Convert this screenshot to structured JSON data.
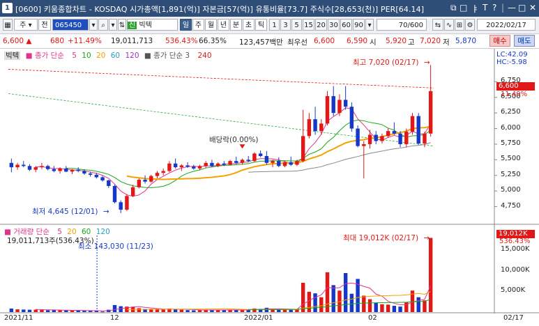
{
  "window": {
    "title": "[0600] 키움종합차트 - KOSDAQ 시가총액[1,891(억)] 자본금[57(억)] 유통비율[73.7] 주식수[28,653(천)] PER[64.14]",
    "icon_label": "1",
    "controls": [
      "⧉",
      "□",
      "ㅑ",
      "T",
      "?",
      "|",
      "—",
      "□",
      "✕"
    ]
  },
  "toolbar": {
    "mode": "주",
    "scope": "전",
    "code": "065450",
    "search_icon": "search-icon",
    "name_tag": "신",
    "stock_name": "빅텍",
    "period_buttons": [
      "일",
      "주",
      "월",
      "년",
      "분",
      "초",
      "틱"
    ],
    "active_period": "일",
    "intervals": [
      "1",
      "3",
      "5",
      "15",
      "20",
      "30",
      "60",
      "90"
    ],
    "count": "70",
    "count_total": "/600",
    "date": "2022/02/17"
  },
  "quote": {
    "price": "6,600",
    "arrow": "▲",
    "change": "680",
    "change_pct": "+11.49%",
    "volume": "19,011,713",
    "vol_ratio": "536.43%",
    "ratio2": "66.35%",
    "amount": "123,457백만",
    "best_ask_label": "최우선",
    "best_ask": "6,600",
    "best_bid": "6,590",
    "open_label": "시",
    "open": "5,920",
    "high_label": "고",
    "high": "7,020",
    "low_label": "저",
    "low": "5,870",
    "buy": "매수",
    "sell": "매도"
  },
  "price_legend": {
    "name": "빅텍",
    "ma_label": "종가 단순",
    "ma_periods": [
      "5",
      "10",
      "20",
      "60",
      "120"
    ],
    "ma_colors": [
      "#e1328d",
      "#19a619",
      "#f5a100",
      "#26a0c8",
      "#9b30c8"
    ],
    "ma2_label": "종가 단순 3",
    "ma2_period": "240"
  },
  "price_axis": {
    "ticks": [
      "6,750",
      "6,500",
      "6,250",
      "6,000",
      "5,750",
      "5,500",
      "5,250",
      "5,000",
      "4,750"
    ],
    "lc": "LC:42.09",
    "hc": "HC:-5.98",
    "current_price": "6,600",
    "current_pct": "11.49%"
  },
  "annotations": {
    "high": "최고 7,020 (02/17)",
    "low": "최저 4,645 (12/01)",
    "dividend": "배당락(0.00%)",
    "vol_max": "최대 19,012K (02/17)",
    "vol_min": "최소 143,030 (11/23)"
  },
  "volume_legend": {
    "label": "거래량 단순",
    "periods": [
      "5",
      "20",
      "60",
      "120"
    ],
    "colors": [
      "#e1328d",
      "#f5a100",
      "#19a619",
      "#26a0c8"
    ],
    "value_line": "19,011,713주(536.43%)"
  },
  "volume_axis": {
    "ticks": [
      "15,000K",
      "10,000K",
      "5,000K"
    ],
    "current": "19,012K",
    "current_pct": "536.43%"
  },
  "date_axis": [
    "2021/11",
    "12",
    "2022/01",
    "02",
    "02/17"
  ],
  "chart_data": {
    "type": "candlestick",
    "price_range": [
      4600,
      7100
    ],
    "volume_range_k": [
      0,
      20000
    ],
    "candles": [
      {
        "o": 5450,
        "h": 5520,
        "l": 5300,
        "c": 5380,
        "v": 900
      },
      {
        "o": 5380,
        "h": 5450,
        "l": 5340,
        "c": 5420,
        "v": 700
      },
      {
        "o": 5420,
        "h": 5480,
        "l": 5380,
        "c": 5400,
        "v": 650
      },
      {
        "o": 5400,
        "h": 5430,
        "l": 5320,
        "c": 5340,
        "v": 600
      },
      {
        "o": 5340,
        "h": 5400,
        "l": 5300,
        "c": 5380,
        "v": 620
      },
      {
        "o": 5380,
        "h": 5450,
        "l": 5350,
        "c": 5400,
        "v": 550
      },
      {
        "o": 5400,
        "h": 5420,
        "l": 5330,
        "c": 5350,
        "v": 480
      },
      {
        "o": 5350,
        "h": 5400,
        "l": 5300,
        "c": 5320,
        "v": 520
      },
      {
        "o": 5320,
        "h": 5380,
        "l": 5280,
        "c": 5360,
        "v": 450
      },
      {
        "o": 5360,
        "h": 5400,
        "l": 5300,
        "c": 5310,
        "v": 430
      },
      {
        "o": 5310,
        "h": 5350,
        "l": 5270,
        "c": 5340,
        "v": 400
      },
      {
        "o": 5340,
        "h": 5380,
        "l": 5300,
        "c": 5320,
        "v": 380
      },
      {
        "o": 5320,
        "h": 5350,
        "l": 5260,
        "c": 5280,
        "v": 360
      },
      {
        "o": 5280,
        "h": 5310,
        "l": 5230,
        "c": 5260,
        "v": 340
      },
      {
        "o": 5260,
        "h": 5290,
        "l": 5200,
        "c": 5220,
        "v": 300
      },
      {
        "o": 5220,
        "h": 5240,
        "l": 5150,
        "c": 5170,
        "v": 143
      },
      {
        "o": 5170,
        "h": 5180,
        "l": 5050,
        "c": 5080,
        "v": 600
      },
      {
        "o": 5080,
        "h": 5100,
        "l": 4800,
        "c": 4820,
        "v": 1800
      },
      {
        "o": 4820,
        "h": 4850,
        "l": 4645,
        "c": 4700,
        "v": 1500
      },
      {
        "o": 4700,
        "h": 4950,
        "l": 4680,
        "c": 4920,
        "v": 1400
      },
      {
        "o": 4920,
        "h": 5100,
        "l": 4900,
        "c": 5060,
        "v": 1300
      },
      {
        "o": 5060,
        "h": 5200,
        "l": 5040,
        "c": 5180,
        "v": 1000
      },
      {
        "o": 5180,
        "h": 5250,
        "l": 5120,
        "c": 5150,
        "v": 800
      },
      {
        "o": 5150,
        "h": 5260,
        "l": 5130,
        "c": 5240,
        "v": 700
      },
      {
        "o": 5240,
        "h": 5320,
        "l": 5200,
        "c": 5290,
        "v": 650
      },
      {
        "o": 5290,
        "h": 5360,
        "l": 5250,
        "c": 5320,
        "v": 700
      },
      {
        "o": 5320,
        "h": 5480,
        "l": 5300,
        "c": 5440,
        "v": 900
      },
      {
        "o": 5440,
        "h": 5520,
        "l": 5360,
        "c": 5380,
        "v": 750
      },
      {
        "o": 5380,
        "h": 5430,
        "l": 5320,
        "c": 5410,
        "v": 600
      },
      {
        "o": 5410,
        "h": 5460,
        "l": 5370,
        "c": 5390,
        "v": 500
      },
      {
        "o": 5390,
        "h": 5420,
        "l": 5340,
        "c": 5360,
        "v": 450
      },
      {
        "o": 5360,
        "h": 5420,
        "l": 5330,
        "c": 5400,
        "v": 500
      },
      {
        "o": 5400,
        "h": 5480,
        "l": 5370,
        "c": 5450,
        "v": 620
      },
      {
        "o": 5450,
        "h": 5500,
        "l": 5380,
        "c": 5400,
        "v": 560
      },
      {
        "o": 5400,
        "h": 5460,
        "l": 5380,
        "c": 5440,
        "v": 520
      },
      {
        "o": 5440,
        "h": 5480,
        "l": 5400,
        "c": 5420,
        "v": 480
      },
      {
        "o": 5420,
        "h": 5500,
        "l": 5410,
        "c": 5480,
        "v": 600
      },
      {
        "o": 5480,
        "h": 5550,
        "l": 5430,
        "c": 5450,
        "v": 620
      },
      {
        "o": 5450,
        "h": 5520,
        "l": 5420,
        "c": 5500,
        "v": 580
      },
      {
        "o": 5500,
        "h": 5560,
        "l": 5460,
        "c": 5480,
        "v": 540
      },
      {
        "o": 5480,
        "h": 5620,
        "l": 5460,
        "c": 5600,
        "v": 900
      },
      {
        "o": 5600,
        "h": 5650,
        "l": 5540,
        "c": 5560,
        "v": 820
      },
      {
        "o": 5560,
        "h": 5640,
        "l": 5420,
        "c": 5450,
        "v": 1100
      },
      {
        "o": 5450,
        "h": 5500,
        "l": 5380,
        "c": 5480,
        "v": 700
      },
      {
        "o": 5480,
        "h": 5540,
        "l": 5380,
        "c": 5400,
        "v": 650
      },
      {
        "o": 5400,
        "h": 5480,
        "l": 5380,
        "c": 5460,
        "v": 600
      },
      {
        "o": 5460,
        "h": 5550,
        "l": 5400,
        "c": 5420,
        "v": 680
      },
      {
        "o": 5420,
        "h": 5500,
        "l": 5400,
        "c": 5480,
        "v": 700
      },
      {
        "o": 5480,
        "h": 6300,
        "l": 5460,
        "c": 5880,
        "v": 7500
      },
      {
        "o": 5880,
        "h": 6250,
        "l": 5840,
        "c": 6150,
        "v": 5200
      },
      {
        "o": 6150,
        "h": 6350,
        "l": 5900,
        "c": 5960,
        "v": 4800
      },
      {
        "o": 5960,
        "h": 6150,
        "l": 5900,
        "c": 6080,
        "v": 3800
      },
      {
        "o": 6080,
        "h": 6600,
        "l": 6050,
        "c": 6520,
        "v": 10200
      },
      {
        "o": 6520,
        "h": 6680,
        "l": 6200,
        "c": 6250,
        "v": 6900
      },
      {
        "o": 6250,
        "h": 6550,
        "l": 6200,
        "c": 6460,
        "v": 5500
      },
      {
        "o": 6460,
        "h": 6680,
        "l": 6300,
        "c": 6350,
        "v": 10000
      },
      {
        "o": 6350,
        "h": 6420,
        "l": 5950,
        "c": 6000,
        "v": 4700
      },
      {
        "o": 6000,
        "h": 6050,
        "l": 5700,
        "c": 5720,
        "v": 8500
      },
      {
        "o": 5720,
        "h": 5800,
        "l": 5200,
        "c": 5750,
        "v": 4200
      },
      {
        "o": 5750,
        "h": 5980,
        "l": 5680,
        "c": 5900,
        "v": 3300
      },
      {
        "o": 5900,
        "h": 5960,
        "l": 5750,
        "c": 5800,
        "v": 2400
      },
      {
        "o": 5800,
        "h": 5920,
        "l": 5760,
        "c": 5880,
        "v": 2000
      },
      {
        "o": 5880,
        "h": 6000,
        "l": 5850,
        "c": 5960,
        "v": 1900
      },
      {
        "o": 5960,
        "h": 6100,
        "l": 5900,
        "c": 5920,
        "v": 1600
      },
      {
        "o": 5920,
        "h": 5960,
        "l": 5700,
        "c": 5750,
        "v": 1400
      },
      {
        "o": 5750,
        "h": 6000,
        "l": 5700,
        "c": 5950,
        "v": 2500
      },
      {
        "o": 5950,
        "h": 6250,
        "l": 5900,
        "c": 6200,
        "v": 5500
      },
      {
        "o": 6200,
        "h": 6250,
        "l": 5740,
        "c": 5760,
        "v": 3800
      },
      {
        "o": 5760,
        "h": 5950,
        "l": 5700,
        "c": 5920,
        "v": 3000
      },
      {
        "o": 5920,
        "h": 7020,
        "l": 5870,
        "c": 6600,
        "v": 19012
      }
    ]
  }
}
